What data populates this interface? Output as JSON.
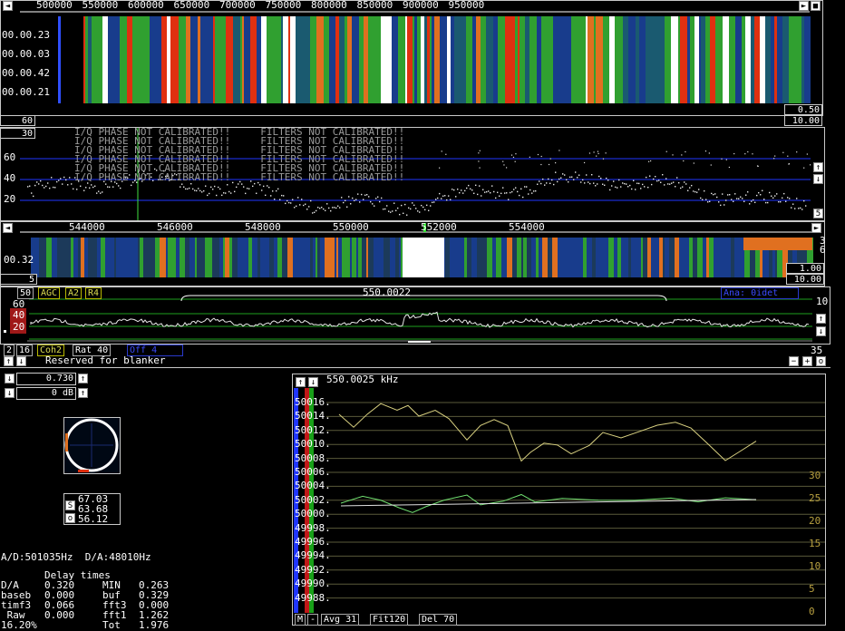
{
  "colors": {
    "accent_blue": "#2036ff",
    "grid_green": "#1ea01e",
    "trace": "#e8e8c8",
    "wf_red": "#e03010",
    "wf_orange": "#e07020",
    "wf_green": "#30a030",
    "wf_blue": "#183c8c"
  },
  "top_freq_ticks": [
    "500000",
    "550000",
    "600000",
    "650000",
    "700000",
    "750000",
    "800000",
    "850000",
    "900000",
    "950000"
  ],
  "top_time_labels": [
    "00.00.23",
    "00.00.03",
    "00.00.42",
    "00.00.21"
  ],
  "top_right_vals": [
    "0.50",
    "10.00"
  ],
  "top_left_vals": [
    "60",
    "30"
  ],
  "warnings": [
    "I/Q PHASE NOT CALIBRATED!!     FILTERS NOT CALIBRATED!!",
    "I/Q PHASE NOT CALIBRATED!!     FILTERS NOT CALIBRATED!!",
    "I/Q PHASE NOT CALIBRATED!!     FILTERS NOT CALIBRATED!!",
    "I/Q PHASE NOT CALIBRATED!!     FILTERS NOT CALIBRATED!!",
    "I/Q PHASE NOT CALIBRATED!!     FILTERS NOT CALIBRATED!!",
    "I/Q PHASE NOT CALIBRATED!!     FILTERS NOT CALIBRATED!!"
  ],
  "spectrum_y_labels": [
    "60",
    "40",
    "20"
  ],
  "spectrum_right_val": "5",
  "mid_freq_ticks": [
    "544000",
    "546000",
    "548000",
    "550000",
    "552000",
    "554000"
  ],
  "mid_time_label": "00.32",
  "mid_right_nums": [
    "3",
    "6"
  ],
  "mid_right_vals": [
    "1.00",
    "10.00"
  ],
  "mid_left_val": "5",
  "controls": {
    "left_num": "50",
    "agc": "AGC",
    "a2": "A2",
    "r4": "R4",
    "center_freq": "550.0022",
    "right_blue": "Ana: 0idet",
    "right_num": "10"
  },
  "bb_y_labels": [
    "60",
    "40",
    "20"
  ],
  "bottom_ctrl": {
    "a": "2",
    "b": "16",
    "coh": "Coh2",
    "rat": "Rat 40",
    "off": "Off  4",
    "right": "35"
  },
  "blanker_label": "Reserved for blanker",
  "volume": {
    "value": "0.730",
    "db": "0 dB"
  },
  "meter": {
    "s_label": "S",
    "o_label": "o",
    "vals": [
      "67.03",
      "63.68",
      "56.12"
    ]
  },
  "ad_da": "A/D:501035Hz  D/A:48010Hz",
  "delay": {
    "title": "Delay times",
    "rows": [
      [
        "D/A",
        "0.320",
        "MIN",
        "0.263"
      ],
      [
        "baseb",
        "0.000",
        "buf",
        "0.329"
      ],
      [
        "timf3",
        "0.066",
        "fft3",
        "0.000"
      ],
      [
        " Raw",
        "0.000",
        "fft1",
        "1.262"
      ],
      [
        "16.20%",
        "",
        "Tot",
        "1.976"
      ]
    ]
  },
  "freq_plot": {
    "title": "550.0025 kHz",
    "y_labels": [
      "50016.",
      "50014.",
      "50012.",
      "50010.",
      "50008.",
      "50006.",
      "50004.",
      "50002.",
      "50000.",
      "49998.",
      "49996.",
      "49994.",
      "49992.",
      "49990.",
      "49988."
    ],
    "right_labels": [
      "30",
      "25",
      "20",
      "15",
      "10",
      "5",
      "0"
    ],
    "bottom": {
      "m": "M",
      "minus": "-",
      "avg": "Avg 31",
      "fit": "Fit120",
      "del": "Del 70"
    }
  }
}
